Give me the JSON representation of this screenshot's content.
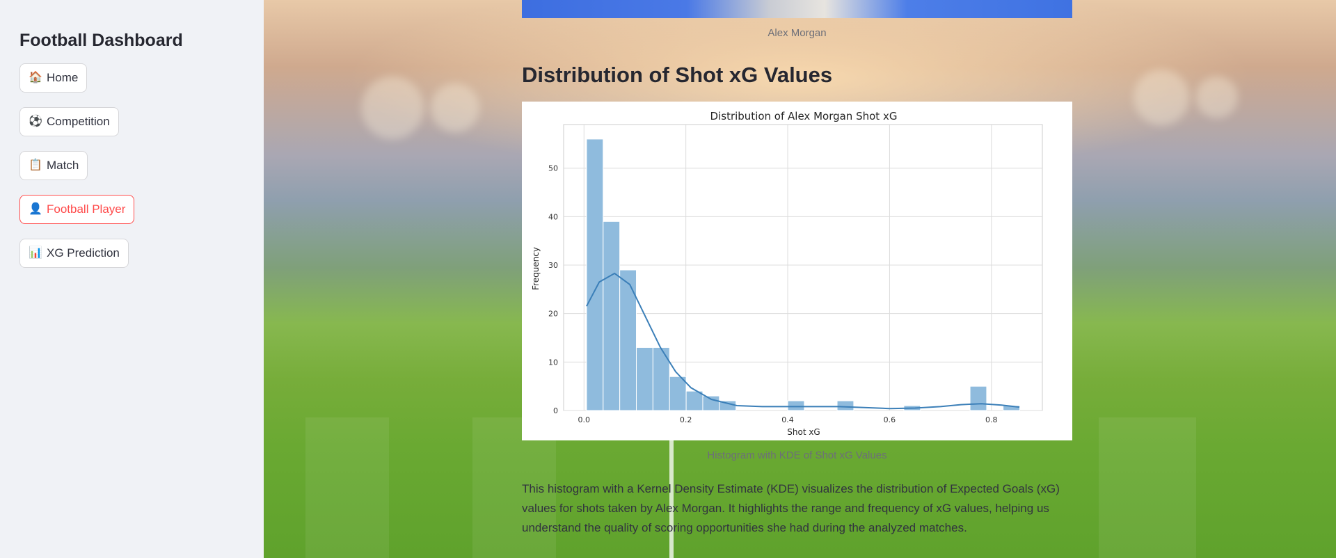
{
  "sidebar": {
    "title": "Football Dashboard",
    "items": [
      {
        "label": "Home",
        "icon": "🏠",
        "active": false
      },
      {
        "label": "Competition",
        "icon": "⚽",
        "active": false
      },
      {
        "label": "Match",
        "icon": "📋",
        "active": false
      },
      {
        "label": "Football Player",
        "icon": "👤",
        "active": true
      },
      {
        "label": "XG Prediction",
        "icon": "📊",
        "active": false
      }
    ]
  },
  "main": {
    "image_caption": "Alex Morgan",
    "section_heading": "Distribution of Shot xG Values",
    "chart_caption": "Histogram with KDE of Shot xG Values",
    "description": "This histogram with a Kernel Density Estimate (KDE) visualizes the distribution of Expected Goals (xG) values for shots taken by Alex Morgan. It highlights the range and frequency of xG values, helping us understand the quality of scoring opportunities she had during the analyzed matches."
  },
  "colors": {
    "accent": "#ff4b4b",
    "bar_fill": "#8fbbdd",
    "kde_line": "#3b7fb8"
  },
  "chart_data": {
    "type": "bar",
    "title": "Distribution of Alex Morgan Shot xG",
    "xlabel": "Shot xG",
    "ylabel": "Frequency",
    "xlim": [
      -0.04,
      0.9
    ],
    "ylim": [
      0,
      59
    ],
    "xticks": [
      0.0,
      0.2,
      0.4,
      0.6,
      0.8
    ],
    "xtick_labels": [
      "0.0",
      "0.2",
      "0.4",
      "0.6",
      "0.8"
    ],
    "yticks": [
      0,
      10,
      20,
      30,
      40,
      50
    ],
    "grid": true,
    "bin_width": 0.0326,
    "bins": [
      {
        "x0": 0.005,
        "count": 56
      },
      {
        "x0": 0.0376,
        "count": 39
      },
      {
        "x0": 0.0702,
        "count": 29
      },
      {
        "x0": 0.1028,
        "count": 13
      },
      {
        "x0": 0.1354,
        "count": 13
      },
      {
        "x0": 0.168,
        "count": 7
      },
      {
        "x0": 0.2006,
        "count": 4
      },
      {
        "x0": 0.2332,
        "count": 3
      },
      {
        "x0": 0.2658,
        "count": 2
      },
      {
        "x0": 0.4,
        "count": 2
      },
      {
        "x0": 0.497,
        "count": 2
      },
      {
        "x0": 0.628,
        "count": 1
      },
      {
        "x0": 0.758,
        "count": 5
      },
      {
        "x0": 0.823,
        "count": 1
      }
    ],
    "kde": {
      "x": [
        0.005,
        0.03,
        0.06,
        0.09,
        0.12,
        0.15,
        0.18,
        0.21,
        0.25,
        0.3,
        0.35,
        0.4,
        0.45,
        0.5,
        0.55,
        0.6,
        0.65,
        0.7,
        0.74,
        0.78,
        0.82,
        0.855
      ],
      "y": [
        21.5,
        26.5,
        28.3,
        26.0,
        19.5,
        13.0,
        8.0,
        4.7,
        2.3,
        1.0,
        0.8,
        0.8,
        0.8,
        0.8,
        0.6,
        0.4,
        0.5,
        0.8,
        1.2,
        1.4,
        1.1,
        0.7
      ]
    }
  }
}
